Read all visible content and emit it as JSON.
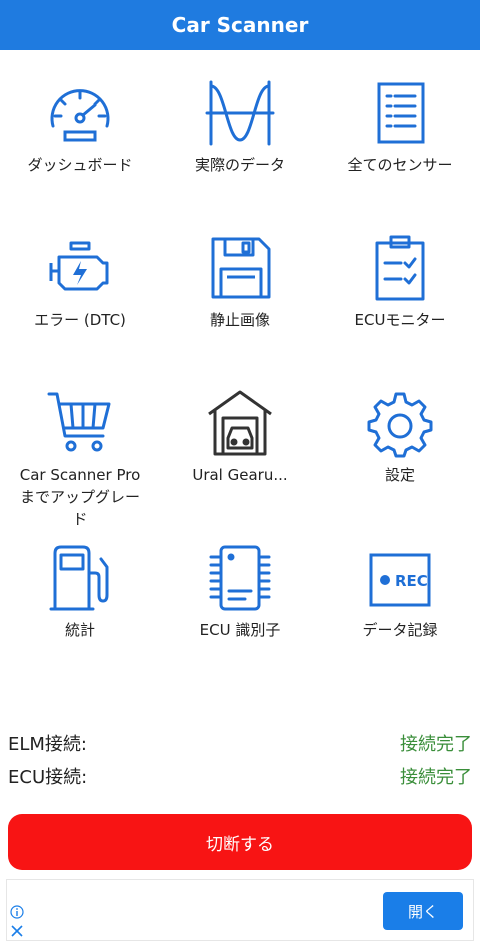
{
  "app": {
    "title": "Car Scanner",
    "accent": "#1f7be0"
  },
  "tiles": [
    {
      "label": "ダッシュボード",
      "icon": "speedometer-icon"
    },
    {
      "label": "実際のデータ",
      "icon": "sine-wave-icon"
    },
    {
      "label": "全てのセンサー",
      "icon": "list-document-icon"
    },
    {
      "label": "エラー (DTC)",
      "icon": "engine-check-icon"
    },
    {
      "label": "静止画像",
      "icon": "floppy-disk-icon"
    },
    {
      "label": "ECUモニター",
      "icon": "clipboard-checklist-icon"
    },
    {
      "label": "Car Scanner Pro\nまでアップグレー\nド",
      "icon": "shopping-cart-icon"
    },
    {
      "label": "Ural Gearu...",
      "icon": "garage-car-icon"
    },
    {
      "label": "設定",
      "icon": "gear-icon"
    },
    {
      "label": "統計",
      "icon": "fuel-pump-icon"
    },
    {
      "label": "ECU 識別子",
      "icon": "chip-icon"
    },
    {
      "label": "データ記録",
      "icon": "rec-icon",
      "rec_text": "REC"
    }
  ],
  "status": {
    "elm_label": "ELM接続:",
    "elm_value": "接続完了",
    "ecu_label": "ECU接続:",
    "ecu_value": "接続完了",
    "ok_color": "#3a8e3a"
  },
  "disconnect_label": "切断する",
  "ad": {
    "open_label": "開く"
  }
}
